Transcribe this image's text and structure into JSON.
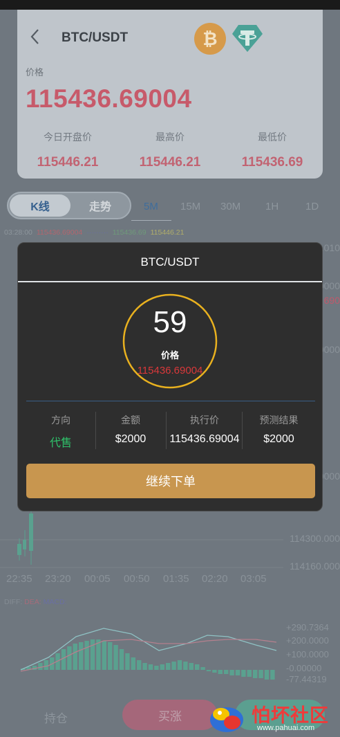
{
  "header": {
    "pair": "BTC/USDT",
    "btc_icon": "₿",
    "price_label": "价格",
    "price": "115436.69004",
    "stats": [
      {
        "label": "今日开盘价",
        "value": "115446.21"
      },
      {
        "label": "最高价",
        "value": "115446.21"
      },
      {
        "label": "最低价",
        "value": "115436.69"
      }
    ]
  },
  "tabs": {
    "segments": [
      "K线",
      "走势"
    ],
    "timeframes": [
      "5M",
      "15M",
      "30M",
      "1H",
      "1D"
    ],
    "active_timeframe": "5M"
  },
  "legend": {
    "time": "03:28:00",
    "v1": "115436.69004",
    "v2": "115436.69",
    "v3": "115446.21"
  },
  "chart": {
    "y_right": [
      ".010",
      "0000",
      "690",
      "0000",
      "0000",
      "114300.000",
      "114160.000"
    ],
    "x_labels": [
      "22:35",
      "23:20",
      "00:05",
      "00:50",
      "01:35",
      "02:20",
      "03:05"
    ],
    "diff_label": "DIFF:",
    "dea_label": "DEA:",
    "macd_label": "MACD:",
    "macd_y": [
      "+290.7364",
      "+200.0000",
      "+100.0000",
      "-0.00000",
      "-77.44319"
    ]
  },
  "modal": {
    "title": "BTC/USDT",
    "countdown": "59",
    "price_label": "价格",
    "price": "115436.69004",
    "columns": [
      {
        "label": "方向",
        "value": "代售"
      },
      {
        "label": "金额",
        "value": "$2000"
      },
      {
        "label": "执行价",
        "value": "115436.69004"
      },
      {
        "label": "预测结果",
        "value": "$2000"
      }
    ],
    "continue_label": "继续下单"
  },
  "bottom": {
    "hold_label": "持仓",
    "up_label": "买涨"
  },
  "watermark": {
    "text": "怕坏社区",
    "url": "www.pahuai.com"
  },
  "colors": {
    "accent_red": "#c75a6a",
    "up_green": "#2ec26a",
    "gold": "#c8964f"
  }
}
